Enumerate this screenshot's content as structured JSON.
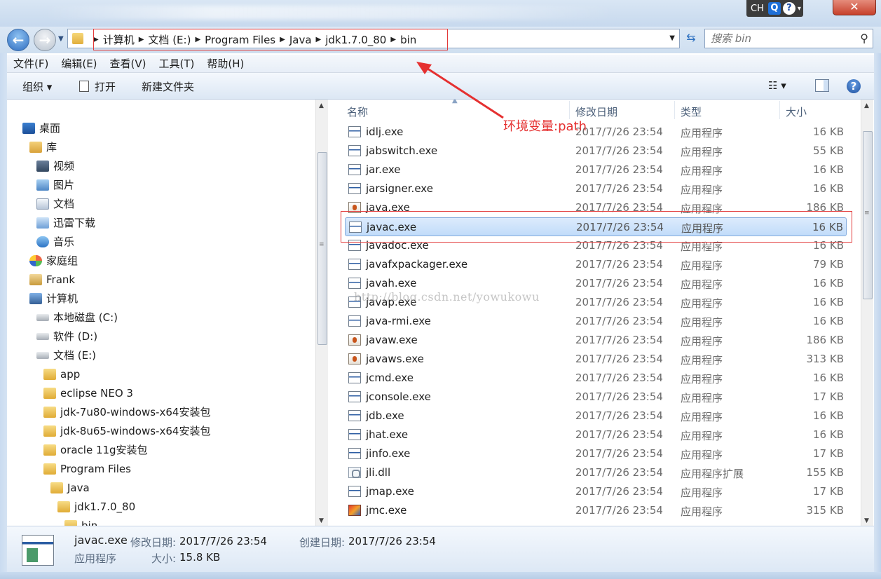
{
  "ime": {
    "lang": "CH",
    "q": "Q",
    "help": "?",
    "drop": "▾"
  },
  "window": {
    "close": "✕"
  },
  "nav": {
    "back": "←",
    "forward": "→"
  },
  "address": {
    "crumbs": [
      "计算机",
      "文档 (E:)",
      "Program Files",
      "Java",
      "jdk1.7.0_80",
      "bin"
    ]
  },
  "search": {
    "placeholder": "搜索 bin"
  },
  "menu": [
    "文件(F)",
    "编辑(E)",
    "查看(V)",
    "工具(T)",
    "帮助(H)"
  ],
  "toolbar": {
    "organize": "组织 ▾",
    "open": "打开",
    "new_folder": "新建文件夹",
    "view": "☷ ▾",
    "help": "?"
  },
  "sidebar": {
    "items": [
      {
        "label": "桌面",
        "icon": "desk"
      },
      {
        "label": "库",
        "icon": "lib"
      },
      {
        "label": "视频",
        "icon": "vid"
      },
      {
        "label": "图片",
        "icon": "pic"
      },
      {
        "label": "文档",
        "icon": "doc"
      },
      {
        "label": "迅雷下载",
        "icon": "dl"
      },
      {
        "label": "音乐",
        "icon": "mus"
      },
      {
        "label": "家庭组",
        "icon": "home"
      },
      {
        "label": "Frank",
        "icon": "user"
      },
      {
        "label": "计算机",
        "icon": "pc"
      },
      {
        "label": "本地磁盘 (C:)",
        "icon": "drive"
      },
      {
        "label": "软件 (D:)",
        "icon": "drive"
      },
      {
        "label": "文档 (E:)",
        "icon": "drive"
      },
      {
        "label": "app",
        "icon": "fold"
      },
      {
        "label": "eclipse NEO 3",
        "icon": "fold"
      },
      {
        "label": "jdk-7u80-windows-x64安装包",
        "icon": "fold"
      },
      {
        "label": "jdk-8u65-windows-x64安装包",
        "icon": "fold"
      },
      {
        "label": "oracle 11g安装包",
        "icon": "fold"
      },
      {
        "label": "Program Files",
        "icon": "fold"
      },
      {
        "label": "Java",
        "icon": "fold"
      },
      {
        "label": "jdk1.7.0_80",
        "icon": "fold"
      },
      {
        "label": "bin",
        "icon": "fold"
      }
    ]
  },
  "columns": {
    "name": "名称",
    "date": "修改日期",
    "type": "类型",
    "size": "大小"
  },
  "files": [
    {
      "name": "idlj.exe",
      "date": "2017/7/26 23:54",
      "type": "应用程序",
      "size": "16 KB",
      "icon": "exe"
    },
    {
      "name": "jabswitch.exe",
      "date": "2017/7/26 23:54",
      "type": "应用程序",
      "size": "55 KB",
      "icon": "exe"
    },
    {
      "name": "jar.exe",
      "date": "2017/7/26 23:54",
      "type": "应用程序",
      "size": "16 KB",
      "icon": "exe"
    },
    {
      "name": "jarsigner.exe",
      "date": "2017/7/26 23:54",
      "type": "应用程序",
      "size": "16 KB",
      "icon": "exe"
    },
    {
      "name": "java.exe",
      "date": "2017/7/26 23:54",
      "type": "应用程序",
      "size": "186 KB",
      "icon": "java"
    },
    {
      "name": "javac.exe",
      "date": "2017/7/26 23:54",
      "type": "应用程序",
      "size": "16 KB",
      "icon": "exe",
      "selected": true
    },
    {
      "name": "javadoc.exe",
      "date": "2017/7/26 23:54",
      "type": "应用程序",
      "size": "16 KB",
      "icon": "exe"
    },
    {
      "name": "javafxpackager.exe",
      "date": "2017/7/26 23:54",
      "type": "应用程序",
      "size": "79 KB",
      "icon": "exe"
    },
    {
      "name": "javah.exe",
      "date": "2017/7/26 23:54",
      "type": "应用程序",
      "size": "16 KB",
      "icon": "exe"
    },
    {
      "name": "javap.exe",
      "date": "2017/7/26 23:54",
      "type": "应用程序",
      "size": "16 KB",
      "icon": "exe"
    },
    {
      "name": "java-rmi.exe",
      "date": "2017/7/26 23:54",
      "type": "应用程序",
      "size": "16 KB",
      "icon": "exe"
    },
    {
      "name": "javaw.exe",
      "date": "2017/7/26 23:54",
      "type": "应用程序",
      "size": "186 KB",
      "icon": "java"
    },
    {
      "name": "javaws.exe",
      "date": "2017/7/26 23:54",
      "type": "应用程序",
      "size": "313 KB",
      "icon": "java"
    },
    {
      "name": "jcmd.exe",
      "date": "2017/7/26 23:54",
      "type": "应用程序",
      "size": "16 KB",
      "icon": "exe"
    },
    {
      "name": "jconsole.exe",
      "date": "2017/7/26 23:54",
      "type": "应用程序",
      "size": "17 KB",
      "icon": "exe"
    },
    {
      "name": "jdb.exe",
      "date": "2017/7/26 23:54",
      "type": "应用程序",
      "size": "16 KB",
      "icon": "exe"
    },
    {
      "name": "jhat.exe",
      "date": "2017/7/26 23:54",
      "type": "应用程序",
      "size": "16 KB",
      "icon": "exe"
    },
    {
      "name": "jinfo.exe",
      "date": "2017/7/26 23:54",
      "type": "应用程序",
      "size": "17 KB",
      "icon": "exe"
    },
    {
      "name": "jli.dll",
      "date": "2017/7/26 23:54",
      "type": "应用程序扩展",
      "size": "155 KB",
      "icon": "dll"
    },
    {
      "name": "jmap.exe",
      "date": "2017/7/26 23:54",
      "type": "应用程序",
      "size": "17 KB",
      "icon": "exe"
    },
    {
      "name": "jmc.exe",
      "date": "2017/7/26 23:54",
      "type": "应用程序",
      "size": "315 KB",
      "icon": "jmc"
    }
  ],
  "annotation": {
    "text": "环境变量:path",
    "color": "#e53030"
  },
  "watermark": "http://blog.csdn.net/yowukowu",
  "details": {
    "name": "javac.exe",
    "modified_label": "修改日期:",
    "modified": "2017/7/26 23:54",
    "created_label": "创建日期:",
    "created": "2017/7/26 23:54",
    "type": "应用程序",
    "size_label": "大小:",
    "size": "15.8 KB"
  }
}
